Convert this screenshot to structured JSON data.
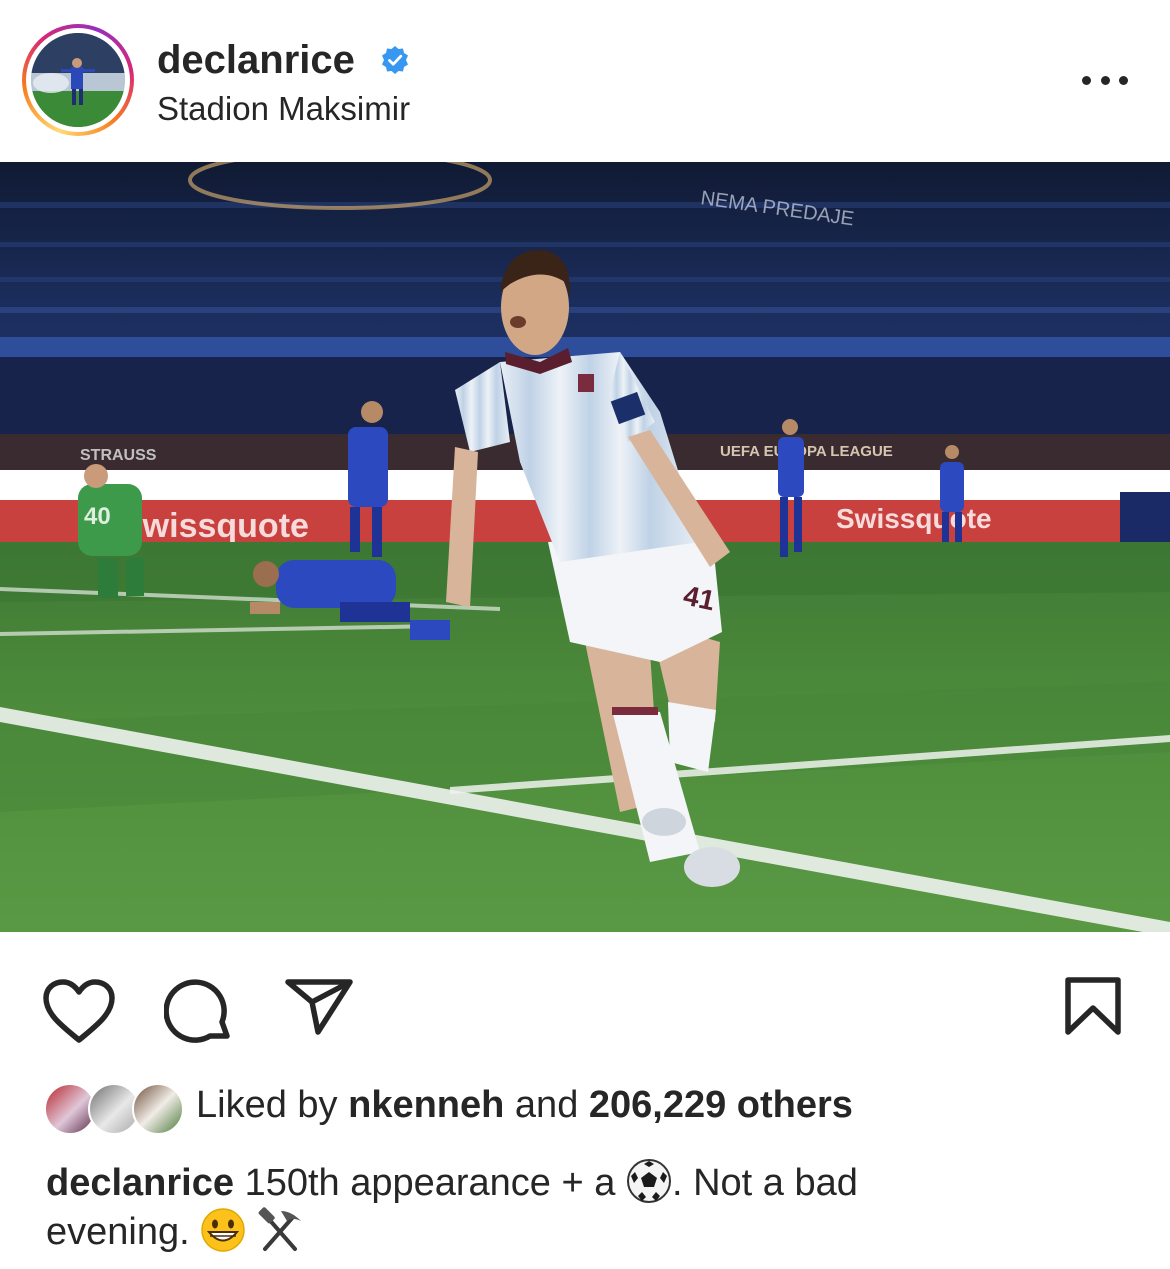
{
  "post": {
    "username": "declanrice",
    "location": "Stadion Maksimir",
    "likes": {
      "prefix": "Liked by",
      "liker": "nkenneh",
      "connector": "and",
      "count_text": "206,229 others"
    },
    "caption": {
      "author": "declanrice",
      "text_before_emoji": "150th appearance + a",
      "text_after_emoji": ". Not a bad",
      "text_line2": "evening.",
      "emojis": [
        "soccer-ball",
        "grinning-face",
        "hammer-and-pick"
      ]
    },
    "photo": {
      "ad_boards": [
        "Swissquote",
        "Swissquote",
        "UEFA EUROPA LEAGUE",
        "STRAUSS"
      ],
      "stand_text": [
        "NEMA PREDAJE"
      ],
      "shirt_number": "41",
      "keeper_number": "40"
    }
  },
  "icons": {
    "verified": "verified-badge-icon",
    "more": "more-options-icon",
    "like": "heart-icon",
    "comment": "comment-icon",
    "share": "send-icon",
    "save": "bookmark-icon"
  },
  "colors": {
    "verified_blue": "#3897f0",
    "text": "#262626",
    "story_ring": [
      "#feda75",
      "#fa7e1e",
      "#d62976",
      "#962fbf"
    ]
  }
}
